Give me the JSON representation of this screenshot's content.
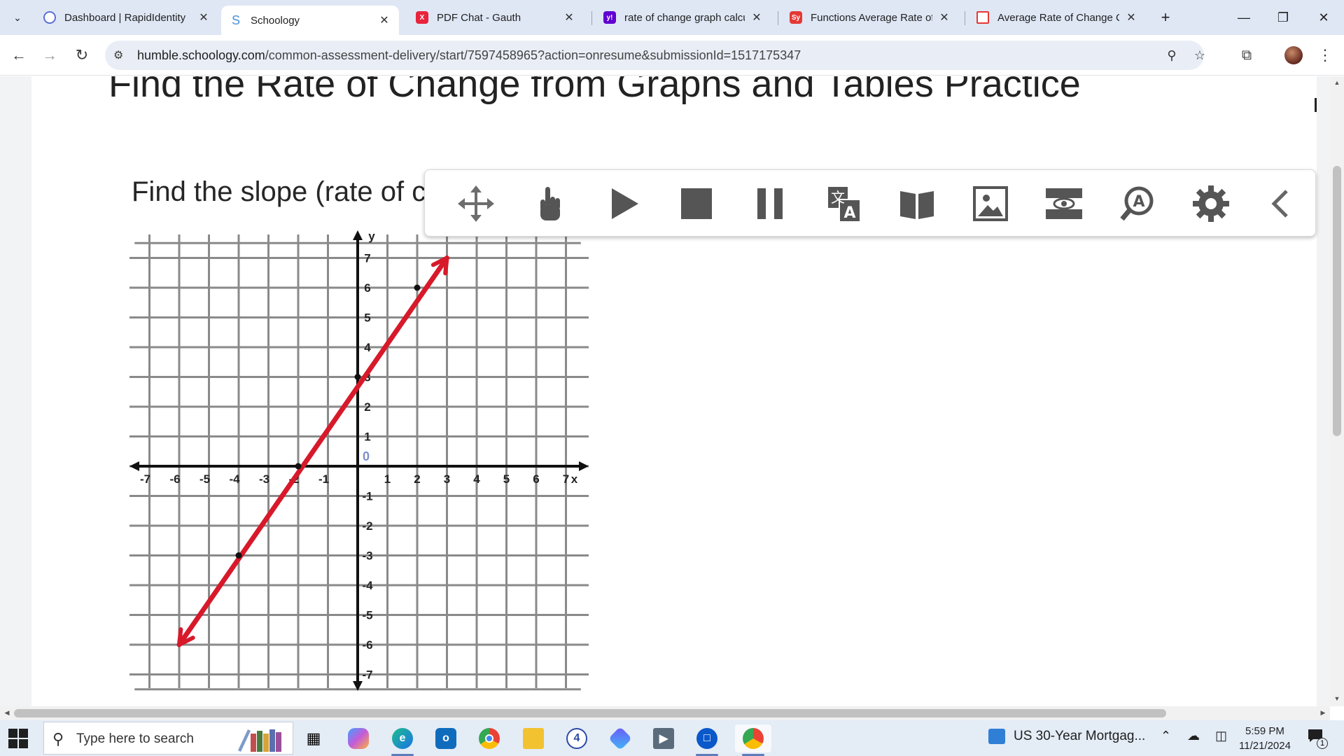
{
  "browser": {
    "tabs": [
      {
        "label": "Dashboard | RapidIdentity",
        "favicon": "rapididentity-icon",
        "color": "#5b6fd6",
        "active": false
      },
      {
        "label": "Schoology",
        "favicon": "schoology-icon",
        "color": "#4a90d9",
        "active": true
      },
      {
        "label": "PDF Chat - Gauth",
        "favicon": "gauth-icon",
        "color": "#e8243c",
        "active": false
      },
      {
        "label": "rate of change graph calcu",
        "favicon": "yahoo-icon",
        "color": "#6001d2",
        "active": false
      },
      {
        "label": "Functions Average Rate of",
        "favicon": "study-icon",
        "color": "#e53935",
        "active": false
      },
      {
        "label": "Average Rate of Change C",
        "favicon": "calculator-icon",
        "color": "#e53935",
        "active": false
      }
    ],
    "url_host": "humble.schoology.com",
    "url_path": "/common-assessment-delivery/start/7597458965?action=onresume&submissionId=1517175347"
  },
  "page": {
    "title": "Find the Rate of Change from Graphs and Tables Practice",
    "question": "Find the slope (rate of change) for the line graphed below."
  },
  "tts_toolbar": {
    "buttons": [
      "move-icon",
      "point-hand-icon",
      "play-icon",
      "stop-icon",
      "pause-icon",
      "translate-icon",
      "dictionary-icon",
      "picture-dictionary-icon",
      "screen-mask-icon",
      "text-magnifier-icon",
      "settings-gear-icon",
      "collapse-chevron-icon"
    ]
  },
  "graph": {
    "axis_x_label": "x",
    "axis_y_label": "y",
    "origin_label": "0",
    "x_ticks": [
      "-7",
      "-6",
      "-5",
      "-4",
      "-3",
      "-2",
      "-1",
      "1",
      "2",
      "3",
      "4",
      "5",
      "6",
      "7"
    ],
    "y_ticks": [
      "7",
      "6",
      "5",
      "4",
      "3",
      "2",
      "1",
      "-1",
      "-2",
      "-3",
      "-4",
      "-5",
      "-6",
      "-7"
    ],
    "line_color": "#d7192a",
    "line_from": [
      -6,
      -6
    ],
    "line_to": [
      3,
      7
    ],
    "marked_points": [
      [
        -4,
        -3
      ],
      [
        -2,
        0
      ],
      [
        0,
        3
      ],
      [
        2,
        6
      ]
    ]
  },
  "taskbar": {
    "search_placeholder": "Type here to search",
    "news": "US 30-Year Mortgag...",
    "time": "5:59 PM",
    "date": "11/21/2024",
    "notification_count": "1"
  }
}
